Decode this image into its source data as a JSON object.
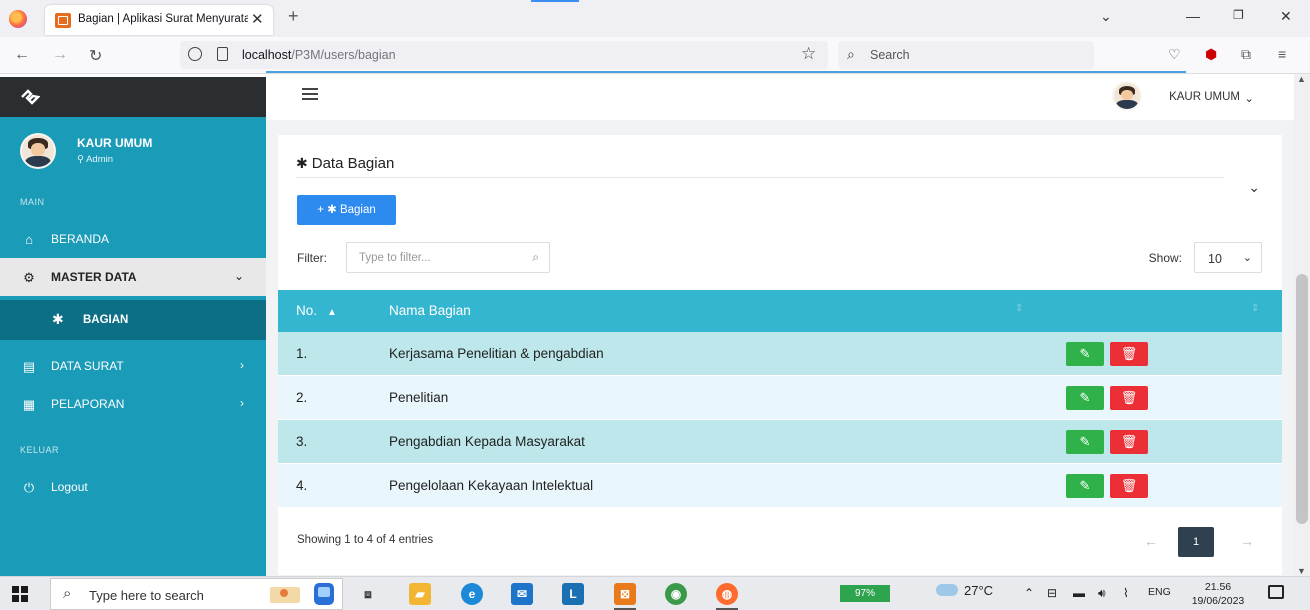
{
  "browser": {
    "tab_title": "Bagian | Aplikasi Surat Menyuratan",
    "tab_close": "✕",
    "new_tab": "+",
    "url_host": "localhost",
    "url_path": "/P3M/users/bagian",
    "search_placeholder": "Search"
  },
  "sidebar": {
    "user_name": "KAUR UMUM",
    "user_role": "Admin",
    "section_main": "MAIN",
    "section_out": "KELUAR",
    "items": [
      {
        "label": "BERANDA",
        "icon": "home-icon"
      },
      {
        "label": "MASTER DATA",
        "icon": "gear-icon"
      },
      {
        "label": "BAGIAN",
        "icon": "puzzle-icon"
      },
      {
        "label": "DATA SURAT",
        "icon": "document-icon"
      },
      {
        "label": "PELAPORAN",
        "icon": "report-icon"
      },
      {
        "label": "Logout",
        "icon": "power-icon"
      }
    ]
  },
  "header": {
    "user_menu_label": "KAUR UMUM"
  },
  "panel": {
    "title": "Data Bagian",
    "add_button_label": "Bagian",
    "filter_label": "Filter:",
    "filter_placeholder": "Type to filter...",
    "show_label": "Show:",
    "show_value": "10",
    "columns": [
      "No.",
      "Nama Bagian"
    ],
    "rows": [
      {
        "no": "1.",
        "name": "Kerjasama Penelitian & pengabdian"
      },
      {
        "no": "2.",
        "name": "Penelitian"
      },
      {
        "no": "3.",
        "name": "Pengabdian Kepada Masyarakat"
      },
      {
        "no": "4.",
        "name": "Pengelolaan Kekayaan Intelektual"
      }
    ],
    "info": "Showing 1 to 4 of 4 entries",
    "current_page": "1"
  },
  "colors": {
    "sidebar": "#1a9bb7",
    "table_header": "#35b6d0",
    "row_odd": "#bde7ea",
    "row_even": "#e9f6fb",
    "edit": "#2fb24a",
    "delete": "#ec2f36",
    "primary": "#2d8bf0"
  },
  "taskbar": {
    "search_placeholder": "Type here to search",
    "battery": "97%",
    "temperature": "27°C",
    "language": "ENG",
    "time": "21.56",
    "date": "19/06/2023"
  }
}
